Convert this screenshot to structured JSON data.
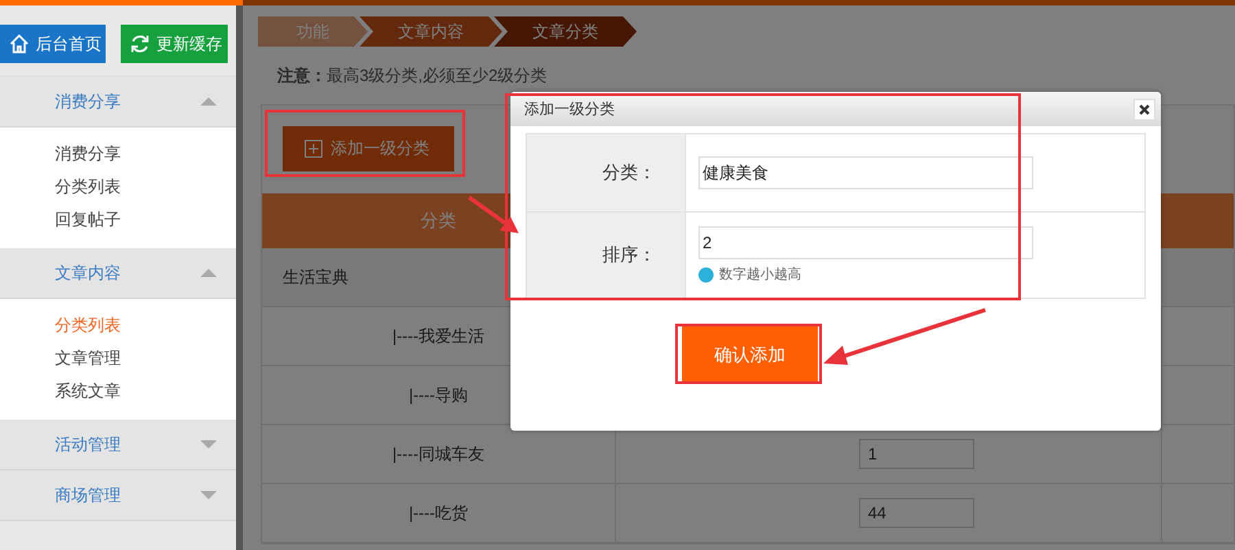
{
  "header_buttons": [
    {
      "label": "后台首页",
      "kind": "home"
    },
    {
      "label": "更新缓存",
      "kind": "refresh"
    }
  ],
  "sidebar": {
    "groups": [
      {
        "title": "消费分享",
        "expanded": true,
        "items": [
          {
            "label": "消费分享",
            "selected": false
          },
          {
            "label": "分类列表",
            "selected": false
          },
          {
            "label": "回复帖子",
            "selected": false
          }
        ]
      },
      {
        "title": "文章内容",
        "expanded": true,
        "items": [
          {
            "label": "分类列表",
            "selected": true
          },
          {
            "label": "文章管理",
            "selected": false
          },
          {
            "label": "系统文章",
            "selected": false
          }
        ]
      },
      {
        "title": "活动管理",
        "expanded": false
      },
      {
        "title": "商场管理",
        "expanded": false
      }
    ]
  },
  "breadcrumb": [
    "功能",
    "文章内容",
    "文章分类"
  ],
  "notice": "**注意：**最高3级分类,必须至少2级分类",
  "add_button": "添加一级分类",
  "table": {
    "columns": [
      "分类"
    ],
    "rows": [
      {
        "name": "生活宝典",
        "kind": "parent"
      },
      {
        "name": "|----我爱生活",
        "kind": "child"
      },
      {
        "name": "|----导购",
        "kind": "child"
      },
      {
        "name": "|----同城车友",
        "kind": "child",
        "order": "1"
      },
      {
        "name": "|----吃货",
        "kind": "child",
        "order": "44"
      }
    ]
  },
  "dialog": {
    "title": "添加一级分类",
    "fields": [
      {
        "label": "分类：",
        "value": "健康美食"
      },
      {
        "label": "排序：",
        "value": "2",
        "hint": "数字越小越高"
      }
    ],
    "confirm": "确认添加"
  }
}
